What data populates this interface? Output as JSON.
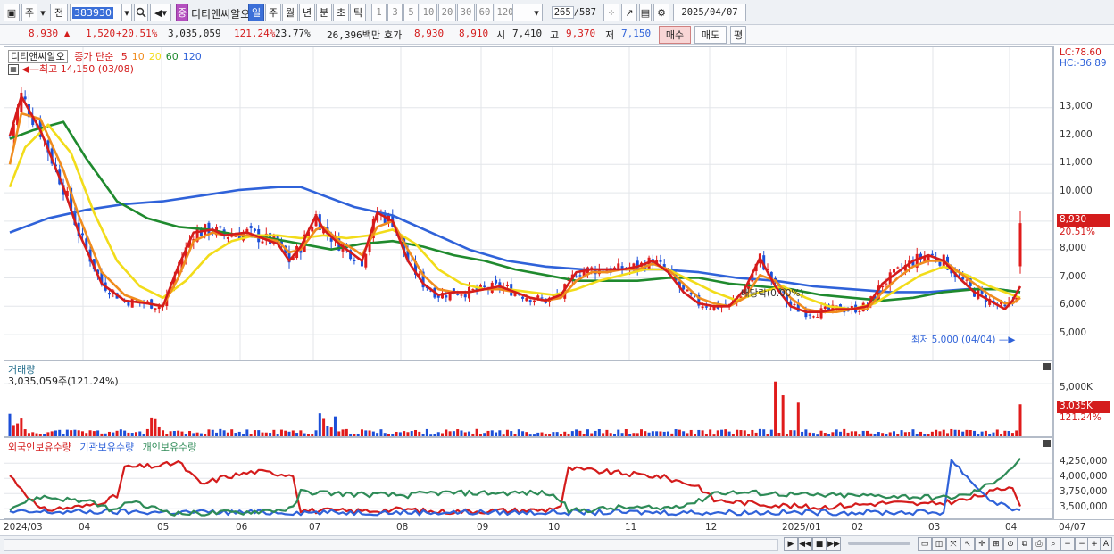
{
  "toolbar": {
    "market": "주",
    "prev": "전",
    "code": "383930",
    "name": "디티앤씨알오",
    "tag": "중",
    "periods": [
      "일",
      "주",
      "월",
      "년",
      "분",
      "초",
      "틱"
    ],
    "active_period": "일",
    "intervals": [
      "1",
      "3",
      "5",
      "10",
      "20",
      "30",
      "60",
      "120"
    ],
    "count_current": "265",
    "count_total": "/587",
    "date": "2025/04/07"
  },
  "quote": {
    "price": "8,930",
    "change": "1,520",
    "change_pct": "+20.51%",
    "volume": "3,035,059",
    "volume_ratio": "121.24%",
    "turnover": "23.77%",
    "amount": "26,396백만",
    "bid_label": "호가",
    "ask": "8,930",
    "bid": "8,910",
    "open_label": "시",
    "open": "7,410",
    "high_label": "고",
    "high": "9,370",
    "low_label": "저",
    "low": "7,150",
    "buy_button": "매수",
    "sell_button": "매도",
    "eval_button": "평"
  },
  "price_pane": {
    "title": "디티앤씨알오",
    "ma_label": "종가 단순",
    "ma_periods": [
      "5",
      "10",
      "20",
      "60",
      "120"
    ],
    "ma_colors": [
      "#d41c1c",
      "#f08c1e",
      "#f2dc1a",
      "#1f8a2e",
      "#2f62d9"
    ],
    "high_note": "최고 14,150 (03/08)",
    "low_note": "최저 5,000 (04/04)",
    "dividend_note": "배당락(0.00%)",
    "lc": "LC:78.60",
    "hc": "HC:-36.89",
    "current_tag": "8,930",
    "current_pct": "20.51%",
    "y_labels": [
      "13,000",
      "12,000",
      "11,000",
      "10,000",
      "9,000",
      "8,000",
      "7,000",
      "6,000",
      "5,000"
    ]
  },
  "volume_pane": {
    "title": "거래량",
    "value": "3,035,059주(121.24%)",
    "y_label": "5,000K",
    "current_tag": "3,035K",
    "current_pct": "121.24%"
  },
  "holder_pane": {
    "legend": [
      "외국인보유수량",
      "기관보유수량",
      "개인보유수량"
    ],
    "colors": [
      "#d41c1c",
      "#2f62d9",
      "#2e8b57"
    ],
    "y_labels": [
      "4,250,000",
      "4,000,000",
      "3,750,000",
      "3,500,000"
    ]
  },
  "x_axis": {
    "labels": [
      "2024/03",
      "04",
      "05",
      "06",
      "07",
      "08",
      "09",
      "10",
      "11",
      "12",
      "2025/01",
      "02",
      "03",
      "04"
    ],
    "end_label": "04/07"
  },
  "chart_data": {
    "type": "candlestick",
    "y_range": [
      4500,
      14500
    ],
    "ma_lines": {
      "5": [
        [
          0,
          12000
        ],
        [
          3,
          13400
        ],
        [
          8,
          12200
        ],
        [
          14,
          10200
        ],
        [
          18,
          8600
        ],
        [
          24,
          6800
        ],
        [
          30,
          6200
        ],
        [
          36,
          6100
        ],
        [
          40,
          6000
        ],
        [
          44,
          7400
        ],
        [
          48,
          8600
        ],
        [
          53,
          8700
        ],
        [
          56,
          8500
        ],
        [
          62,
          8600
        ],
        [
          66,
          8400
        ],
        [
          70,
          8200
        ],
        [
          73,
          7600
        ],
        [
          76,
          8100
        ],
        [
          80,
          9200
        ],
        [
          82,
          8700
        ],
        [
          86,
          8200
        ],
        [
          90,
          7800
        ],
        [
          92,
          7600
        ],
        [
          96,
          9300
        ],
        [
          100,
          9000
        ],
        [
          104,
          7600
        ],
        [
          108,
          6800
        ],
        [
          112,
          6400
        ],
        [
          116,
          6500
        ],
        [
          120,
          6500
        ],
        [
          124,
          6600
        ],
        [
          128,
          6700
        ],
        [
          132,
          6500
        ],
        [
          136,
          6300
        ],
        [
          140,
          6200
        ],
        [
          144,
          6400
        ],
        [
          148,
          7200
        ],
        [
          152,
          7300
        ],
        [
          156,
          7300
        ],
        [
          160,
          7300
        ],
        [
          164,
          7400
        ],
        [
          168,
          7600
        ],
        [
          172,
          7200
        ],
        [
          176,
          6500
        ],
        [
          180,
          6100
        ],
        [
          184,
          6000
        ],
        [
          188,
          6000
        ],
        [
          192,
          6600
        ],
        [
          196,
          7700
        ],
        [
          200,
          6700
        ],
        [
          204,
          6000
        ],
        [
          208,
          5800
        ],
        [
          212,
          5800
        ],
        [
          216,
          5900
        ],
        [
          220,
          5900
        ],
        [
          224,
          6000
        ],
        [
          228,
          6800
        ],
        [
          232,
          7200
        ],
        [
          236,
          7600
        ],
        [
          240,
          7800
        ],
        [
          244,
          7600
        ],
        [
          248,
          7000
        ],
        [
          252,
          6500
        ],
        [
          256,
          6200
        ],
        [
          260,
          5900
        ],
        [
          262,
          6200
        ],
        [
          264,
          6700
        ]
      ],
      "10": [
        [
          0,
          11000
        ],
        [
          3,
          12800
        ],
        [
          8,
          12600
        ],
        [
          14,
          10800
        ],
        [
          18,
          9200
        ],
        [
          24,
          7200
        ],
        [
          30,
          6400
        ],
        [
          36,
          6100
        ],
        [
          40,
          6000
        ],
        [
          44,
          7000
        ],
        [
          48,
          8300
        ],
        [
          53,
          8600
        ],
        [
          56,
          8500
        ],
        [
          62,
          8500
        ],
        [
          66,
          8400
        ],
        [
          70,
          8300
        ],
        [
          73,
          7900
        ],
        [
          76,
          8000
        ],
        [
          80,
          8700
        ],
        [
          82,
          8800
        ],
        [
          86,
          8300
        ],
        [
          90,
          8000
        ],
        [
          92,
          7800
        ],
        [
          96,
          8800
        ],
        [
          100,
          9000
        ],
        [
          104,
          8000
        ],
        [
          108,
          7100
        ],
        [
          112,
          6600
        ],
        [
          116,
          6500
        ],
        [
          120,
          6500
        ],
        [
          124,
          6600
        ],
        [
          128,
          6600
        ],
        [
          132,
          6500
        ],
        [
          136,
          6300
        ],
        [
          140,
          6200
        ],
        [
          144,
          6300
        ],
        [
          148,
          6900
        ],
        [
          152,
          7200
        ],
        [
          156,
          7200
        ],
        [
          160,
          7300
        ],
        [
          164,
          7300
        ],
        [
          168,
          7500
        ],
        [
          172,
          7300
        ],
        [
          176,
          6800
        ],
        [
          180,
          6300
        ],
        [
          184,
          6100
        ],
        [
          188,
          6000
        ],
        [
          192,
          6300
        ],
        [
          196,
          7100
        ],
        [
          200,
          6900
        ],
        [
          204,
          6300
        ],
        [
          208,
          5900
        ],
        [
          212,
          5800
        ],
        [
          216,
          5800
        ],
        [
          220,
          5900
        ],
        [
          224,
          5900
        ],
        [
          228,
          6500
        ],
        [
          232,
          7000
        ],
        [
          236,
          7400
        ],
        [
          240,
          7600
        ],
        [
          244,
          7600
        ],
        [
          248,
          7200
        ],
        [
          252,
          6800
        ],
        [
          256,
          6400
        ],
        [
          260,
          6100
        ],
        [
          262,
          6100
        ],
        [
          264,
          6300
        ]
      ],
      "20": [
        [
          0,
          10200
        ],
        [
          4,
          11600
        ],
        [
          10,
          12400
        ],
        [
          16,
          11400
        ],
        [
          22,
          9300
        ],
        [
          28,
          7600
        ],
        [
          34,
          6700
        ],
        [
          40,
          6300
        ],
        [
          46,
          6900
        ],
        [
          52,
          7800
        ],
        [
          58,
          8300
        ],
        [
          64,
          8500
        ],
        [
          70,
          8500
        ],
        [
          76,
          8400
        ],
        [
          82,
          8500
        ],
        [
          88,
          8400
        ],
        [
          94,
          8500
        ],
        [
          100,
          8700
        ],
        [
          106,
          8200
        ],
        [
          112,
          7300
        ],
        [
          118,
          6800
        ],
        [
          124,
          6600
        ],
        [
          130,
          6600
        ],
        [
          136,
          6500
        ],
        [
          142,
          6400
        ],
        [
          148,
          6600
        ],
        [
          154,
          6900
        ],
        [
          160,
          7100
        ],
        [
          166,
          7300
        ],
        [
          172,
          7300
        ],
        [
          178,
          6900
        ],
        [
          184,
          6500
        ],
        [
          190,
          6200
        ],
        [
          196,
          6500
        ],
        [
          202,
          6700
        ],
        [
          208,
          6300
        ],
        [
          214,
          6000
        ],
        [
          220,
          5900
        ],
        [
          226,
          6100
        ],
        [
          232,
          6600
        ],
        [
          238,
          7100
        ],
        [
          244,
          7400
        ],
        [
          250,
          7100
        ],
        [
          256,
          6700
        ],
        [
          262,
          6400
        ],
        [
          264,
          6300
        ]
      ],
      "60": [
        [
          0,
          11900
        ],
        [
          6,
          12200
        ],
        [
          14,
          12500
        ],
        [
          20,
          11200
        ],
        [
          28,
          9700
        ],
        [
          36,
          9100
        ],
        [
          44,
          8800
        ],
        [
          52,
          8700
        ],
        [
          60,
          8500
        ],
        [
          68,
          8400
        ],
        [
          76,
          8200
        ],
        [
          84,
          8000
        ],
        [
          92,
          8200
        ],
        [
          100,
          8300
        ],
        [
          108,
          8100
        ],
        [
          116,
          7800
        ],
        [
          124,
          7600
        ],
        [
          132,
          7300
        ],
        [
          140,
          7100
        ],
        [
          148,
          6900
        ],
        [
          156,
          6900
        ],
        [
          164,
          6900
        ],
        [
          172,
          7000
        ],
        [
          180,
          7000
        ],
        [
          188,
          6800
        ],
        [
          196,
          6700
        ],
        [
          204,
          6600
        ],
        [
          212,
          6400
        ],
        [
          220,
          6300
        ],
        [
          228,
          6200
        ],
        [
          236,
          6300
        ],
        [
          244,
          6500
        ],
        [
          252,
          6600
        ],
        [
          258,
          6600
        ],
        [
          264,
          6500
        ]
      ],
      "120": [
        [
          0,
          8600
        ],
        [
          10,
          9100
        ],
        [
          20,
          9400
        ],
        [
          30,
          9600
        ],
        [
          40,
          9700
        ],
        [
          50,
          9900
        ],
        [
          60,
          10100
        ],
        [
          70,
          10200
        ],
        [
          76,
          10200
        ],
        [
          82,
          9900
        ],
        [
          90,
          9500
        ],
        [
          100,
          9200
        ],
        [
          110,
          8600
        ],
        [
          120,
          8000
        ],
        [
          130,
          7600
        ],
        [
          140,
          7400
        ],
        [
          150,
          7300
        ],
        [
          160,
          7300
        ],
        [
          170,
          7300
        ],
        [
          180,
          7200
        ],
        [
          190,
          7000
        ],
        [
          200,
          6900
        ],
        [
          210,
          6700
        ],
        [
          220,
          6600
        ],
        [
          230,
          6500
        ],
        [
          240,
          6500
        ],
        [
          250,
          6600
        ],
        [
          258,
          6600
        ],
        [
          264,
          6500
        ]
      ]
    },
    "last_candle": {
      "open": 7410,
      "high": 9370,
      "low": 7150,
      "close": 8930
    },
    "volume_spikes_k": [
      [
        200,
        5200
      ],
      [
        202,
        3900
      ],
      [
        206,
        3200
      ],
      [
        264,
        3035
      ]
    ],
    "holders": {
      "외국인보유수량": [
        [
          0,
          4050000
        ],
        [
          8,
          3480000
        ],
        [
          20,
          3540000
        ],
        [
          28,
          3700000
        ],
        [
          30,
          4180000
        ],
        [
          40,
          4210000
        ],
        [
          44,
          4270000
        ],
        [
          50,
          3900000
        ],
        [
          56,
          4020000
        ],
        [
          64,
          4110000
        ],
        [
          74,
          4060000
        ],
        [
          76,
          3470000
        ],
        [
          90,
          3460000
        ],
        [
          104,
          3490000
        ],
        [
          110,
          3450000
        ],
        [
          140,
          3480000
        ],
        [
          144,
          3550000
        ],
        [
          146,
          4160000
        ],
        [
          160,
          4080000
        ],
        [
          170,
          4030000
        ],
        [
          180,
          3870000
        ],
        [
          184,
          3640000
        ],
        [
          196,
          3580000
        ],
        [
          210,
          3520000
        ],
        [
          230,
          3600000
        ],
        [
          240,
          3570000
        ],
        [
          250,
          3650000
        ],
        [
          262,
          3880000
        ],
        [
          264,
          3570000
        ]
      ],
      "기관보유수량": [
        [
          0,
          3440000
        ],
        [
          20,
          3450000
        ],
        [
          60,
          3440000
        ],
        [
          120,
          3440000
        ],
        [
          200,
          3440000
        ],
        [
          244,
          3440000
        ],
        [
          246,
          4300000
        ],
        [
          252,
          3900000
        ],
        [
          256,
          3650000
        ],
        [
          262,
          3500000
        ],
        [
          264,
          3430000
        ]
      ],
      "개인보유수량": [
        [
          0,
          3520000
        ],
        [
          8,
          3700000
        ],
        [
          20,
          3620000
        ],
        [
          28,
          3460000
        ],
        [
          30,
          3620000
        ],
        [
          44,
          3420000
        ],
        [
          60,
          3440000
        ],
        [
          74,
          3500000
        ],
        [
          76,
          3780000
        ],
        [
          90,
          3740000
        ],
        [
          104,
          3720000
        ],
        [
          110,
          3760000
        ],
        [
          140,
          3760000
        ],
        [
          144,
          3650000
        ],
        [
          146,
          3460000
        ],
        [
          160,
          3520000
        ],
        [
          170,
          3500000
        ],
        [
          180,
          3620000
        ],
        [
          184,
          3770000
        ],
        [
          196,
          3760000
        ],
        [
          210,
          3720000
        ],
        [
          230,
          3710000
        ],
        [
          244,
          3680000
        ],
        [
          250,
          3720000
        ],
        [
          256,
          3900000
        ],
        [
          260,
          4080000
        ],
        [
          264,
          4300000
        ]
      ]
    }
  }
}
